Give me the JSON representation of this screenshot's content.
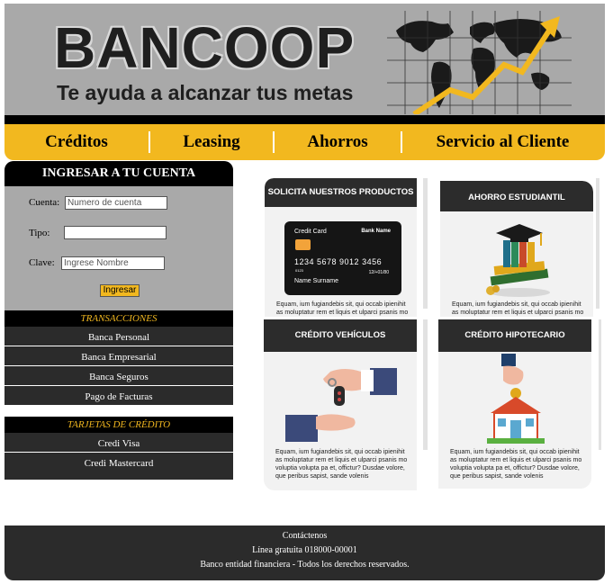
{
  "header": {
    "logo": "BANCOOP",
    "tagline": "Te ayuda a alcanzar tus metas"
  },
  "nav": {
    "items": [
      "Créditos",
      "Leasing",
      "Ahorros",
      "Servicio al Cliente"
    ]
  },
  "login": {
    "title": "INGRESAR A TU CUENTA",
    "cuenta_label": "Cuenta:",
    "cuenta_placeholder": "Numero de cuenta",
    "tipo_label": "Tipo:",
    "tipo_value": "",
    "clave_label": "Clave:",
    "clave_placeholder": "Ingrese Nombre",
    "button_label": "Ingresar"
  },
  "transacciones": {
    "title": "TRANSACCIONES",
    "items": [
      "Banca Personal",
      "Banca Empresarial",
      "Banca Seguros",
      "Pago de Facturas"
    ]
  },
  "tarjetas": {
    "title": "TARJETAS DE CRÉDITO",
    "items": [
      "Credi Visa",
      "Credi Mastercard"
    ]
  },
  "products": {
    "solicita": {
      "title": "SOLICITA NUESTROS PRODUCTOS",
      "card_label": "Credit Card",
      "card_bank": "Bank Name",
      "card_number": "1234  5678  9012  3456",
      "card_small": "0123",
      "card_valid": "12/+01/80",
      "card_name": "Name Surname",
      "desc": "Equam, ium fugiandebis sit, qui occab ipienihit as moluptatur rem et liquis et ulparci psanis mo"
    },
    "ahorro": {
      "title": "AHORRO ESTUDIANTIL",
      "desc": "Equam, ium fugiandebis sit, qui occab ipienihit as moluptatur rem et liquis et ulparci psanis mo"
    },
    "vehiculos": {
      "title": "CRÉDITO VEHÍCULOS",
      "desc": "Equam, ium fugiandebis sit, qui occab ipienihit as moluptatur rem et liquis et ulparci psanis mo voluptia volupta pa et, offictur? Dusdae volore, que peribus sapist, sande volenis"
    },
    "hipotecario": {
      "title": "CRÉDITO HIPOTECARIO",
      "desc": "Equam, ium fugiandebis sit, qui occab ipienihit as moluptatur rem et liquis et ulparci psanis mo voluptia volupta pa et, offictur? Dusdae volore, que peribus sapist, sande volenis"
    }
  },
  "footer": {
    "line1": "Contáctenos",
    "line2": "Línea gratuita 018000-00001",
    "line3": "Banco entidad financiera - Todos los derechos reservados."
  },
  "colors": {
    "accent": "#f2b81f",
    "dark": "#2b2b2b",
    "banner_gray": "#a9a9a9"
  }
}
